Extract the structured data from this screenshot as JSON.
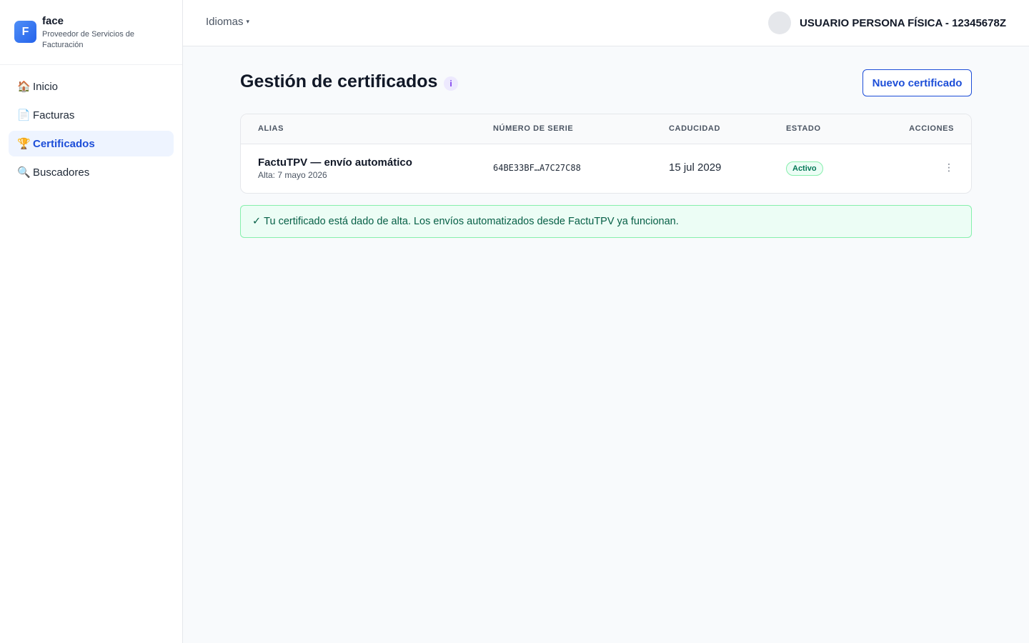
{
  "brand": {
    "logo_letter": "F",
    "name": "face",
    "subtitle": "Proveedor de Servicios de Facturación"
  },
  "sidebar": {
    "items": [
      {
        "label": "Inicio",
        "icon": "house-icon",
        "glyph": "🏠",
        "active": false
      },
      {
        "label": "Facturas",
        "icon": "document-icon",
        "glyph": "📄",
        "active": false
      },
      {
        "label": "Certificados",
        "icon": "trophy-icon",
        "glyph": "🏆",
        "active": true
      },
      {
        "label": "Buscadores",
        "icon": "magnifier-icon",
        "glyph": "🔍",
        "active": false
      }
    ]
  },
  "header": {
    "language_label": "Idiomas",
    "language_caret": "▾",
    "user_name": "USUARIO PERSONA FÍSICA - 12345678Z"
  },
  "main": {
    "title": "Gestión de certificados",
    "info_glyph": "i",
    "new_button": "Nuevo certificado",
    "table": {
      "columns": [
        "ALIAS",
        "NÚMERO DE SERIE",
        "CADUCIDAD",
        "ESTADO",
        "ACCIONES"
      ],
      "rows": [
        {
          "alias": "FactuTPV — envío automático",
          "created": "Alta: 7 mayo 2026",
          "serial": "64BE33BF…A7C27C88",
          "expiry": "15 jul 2029",
          "status": "Activo",
          "actions_glyph": "⋮"
        }
      ]
    },
    "alert": {
      "check": "✓",
      "text": "Tu certificado está dado de alta. Los envíos automatizados desde FactuTPV ya funcionan."
    }
  },
  "colors": {
    "accent": "#1d4ed8",
    "active_nav_bg": "#eef4ff",
    "success_bg": "#ecfdf5",
    "success_border": "#86efac",
    "success_text": "#065f46",
    "info_badge": "#7c3aed"
  }
}
